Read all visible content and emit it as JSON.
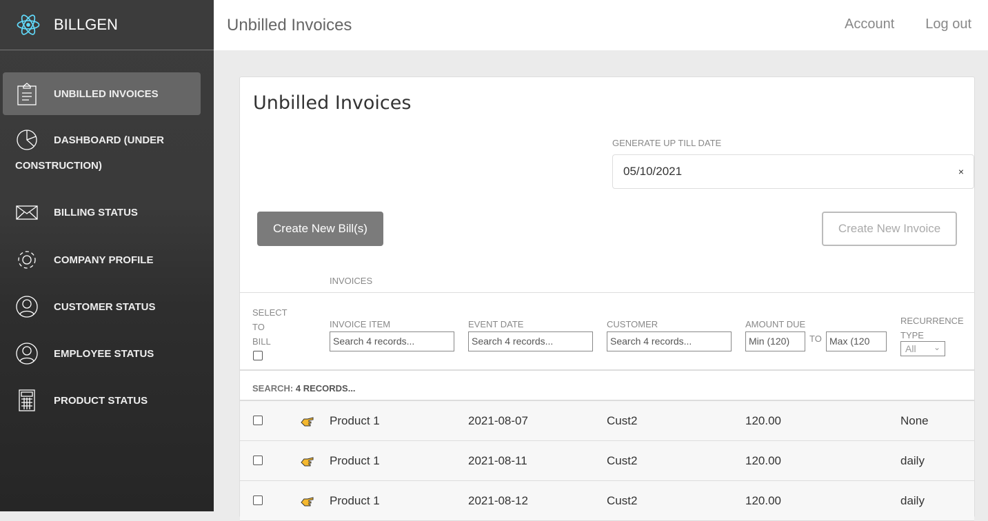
{
  "brand": {
    "name": "BILLGEN",
    "logo_icon": "react-atom-icon",
    "logo_color": "#61dafb"
  },
  "sidebar": {
    "items": [
      {
        "label": "UNBILLED INVOICES",
        "icon": "clipboard-icon",
        "active": true
      },
      {
        "label": "DASHBOARD (UNDER",
        "label2": "CONSTRUCTION)",
        "icon": "pie-chart-icon"
      },
      {
        "label": "BILLING STATUS",
        "icon": "envelope-icon"
      },
      {
        "label": "COMPANY PROFILE",
        "icon": "gear-icon"
      },
      {
        "label": "CUSTOMER STATUS",
        "icon": "user-icon"
      },
      {
        "label": "EMPLOYEE STATUS",
        "icon": "user-icon"
      },
      {
        "label": "PRODUCT STATUS",
        "icon": "calculator-icon"
      }
    ]
  },
  "header": {
    "title": "Unbilled Invoices",
    "account": "Account",
    "logout": "Log out"
  },
  "card": {
    "title": "Unbilled Invoices",
    "date_label": "GENERATE UP TILL DATE",
    "date_value": "05/10/2021",
    "clear": "×",
    "create_bills": "Create New Bill(s)",
    "create_invoice": "Create New Invoice",
    "section": "INVOICES",
    "columns": {
      "select1": "SELECT",
      "select2": "TO",
      "select3": "BILL",
      "item": "INVOICE ITEM",
      "date": "EVENT DATE",
      "customer": "CUSTOMER",
      "amount": "AMOUNT DUE",
      "to": "TO",
      "recurrence1": "RECURRENCE",
      "recurrence2": "TYPE"
    },
    "filters": {
      "item": "Search 4 records...",
      "date": "Search 4 records...",
      "customer": "Search 4 records...",
      "min": "Min (120)",
      "max": "Max (120",
      "recurrence": "All"
    },
    "search_label": "SEARCH:",
    "search_value": "4 records...",
    "rows": [
      {
        "item": "Product 1",
        "date": "2021-08-07",
        "customer": "Cust2",
        "amount": "120.00",
        "recurrence": "None"
      },
      {
        "item": "Product 1",
        "date": "2021-08-11",
        "customer": "Cust2",
        "amount": "120.00",
        "recurrence": "daily"
      },
      {
        "item": "Product 1",
        "date": "2021-08-12",
        "customer": "Cust2",
        "amount": "120.00",
        "recurrence": "daily"
      }
    ]
  }
}
